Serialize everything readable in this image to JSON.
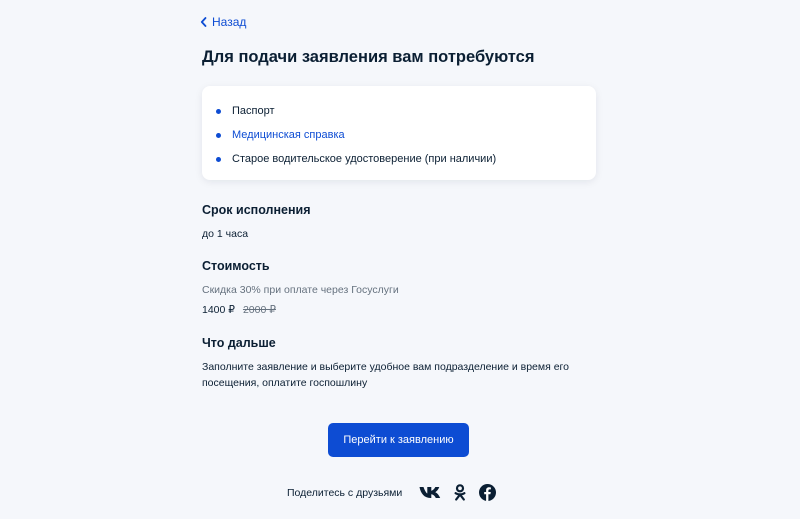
{
  "nav": {
    "back_label": "Назад"
  },
  "page": {
    "title": "Для подачи заявления вам потребуются"
  },
  "documents": {
    "items": [
      {
        "label": "Паспорт"
      },
      {
        "label": "Медицинская справка"
      },
      {
        "label": "Старое водительское удостоверение (при наличии)"
      }
    ]
  },
  "term": {
    "heading": "Срок исполнения",
    "value": "до 1 часа"
  },
  "cost": {
    "heading": "Стоимость",
    "discount": "Скидка 30% при оплате через Госуслуги",
    "price": "1400 ₽",
    "old_price": "2000 ₽"
  },
  "next": {
    "heading": "Что дальше",
    "text": "Заполните заявление и выберите удобное вам подразделение и время его посещения, оплатите госпошлину"
  },
  "actions": {
    "primary_label": "Перейти к заявлению"
  },
  "share": {
    "label": "Поделитесь с друзьями",
    "networks": [
      "vk-icon",
      "odnoklassniki-icon",
      "facebook-icon"
    ]
  },
  "colors": {
    "accent": "#0d4cd3",
    "text": "#0b1f33",
    "muted": "#66727f",
    "background": "#f5f7fb"
  }
}
